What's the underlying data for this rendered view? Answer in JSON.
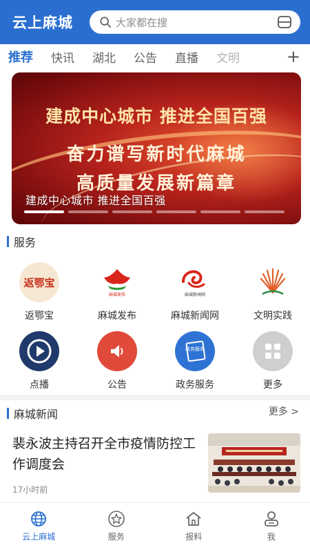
{
  "header": {
    "app_title": "云上麻城",
    "search_placeholder": "大家都在搜",
    "icons": [
      "search-icon",
      "scan-icon"
    ]
  },
  "tabs": [
    {
      "label": "推荐",
      "active": true
    },
    {
      "label": "快讯",
      "active": false
    },
    {
      "label": "湖北",
      "active": false
    },
    {
      "label": "公告",
      "active": false
    },
    {
      "label": "直播",
      "active": false
    },
    {
      "label": "文明",
      "active": false
    }
  ],
  "tabs_add": "+",
  "banner": {
    "slogan_line1": "建成中心城市  推进全国百强",
    "slogan_line2": "奋力谱写新时代麻城",
    "slogan_line3": "高质量发展新篇章",
    "caption": "建成中心城市 推进全国百强",
    "slide_count": 6,
    "active_slide": 1
  },
  "services": {
    "title": "服务",
    "items": [
      {
        "label": "返鄂宝",
        "icon": "fanebao-logo-icon",
        "icon_text": "返鄂宝"
      },
      {
        "label": "麻城发布",
        "icon": "macheng-fabu-logo-icon",
        "icon_text": "麻城发布"
      },
      {
        "label": "麻城新闻网",
        "icon": "macheng-news-logo-icon",
        "icon_text": "麻城新闻网"
      },
      {
        "label": "文明实践",
        "icon": "civilization-practice-logo-icon"
      },
      {
        "label": "点播",
        "icon": "play-icon"
      },
      {
        "label": "公告",
        "icon": "speaker-icon"
      },
      {
        "label": "政务服务",
        "icon": "government-service-icon",
        "icon_text": "政务服务"
      },
      {
        "label": "更多",
        "icon": "grid-icon"
      }
    ]
  },
  "news": {
    "title": "麻城新闻",
    "more": "更多 >",
    "items": [
      {
        "title": "裴永波主持召开全市疫情防控工作调度会",
        "time": "17小时前"
      }
    ]
  },
  "bottom_nav": [
    {
      "label": "云上麻城",
      "icon": "globe-icon",
      "active": true
    },
    {
      "label": "服务",
      "icon": "star-icon",
      "active": false
    },
    {
      "label": "报料",
      "icon": "home-icon",
      "active": false
    },
    {
      "label": "我",
      "icon": "user-icon",
      "active": false
    }
  ],
  "colors": {
    "primary": "#2a6fd0",
    "banner_red": "#b8231c",
    "accent_red": "#e04a3a"
  }
}
